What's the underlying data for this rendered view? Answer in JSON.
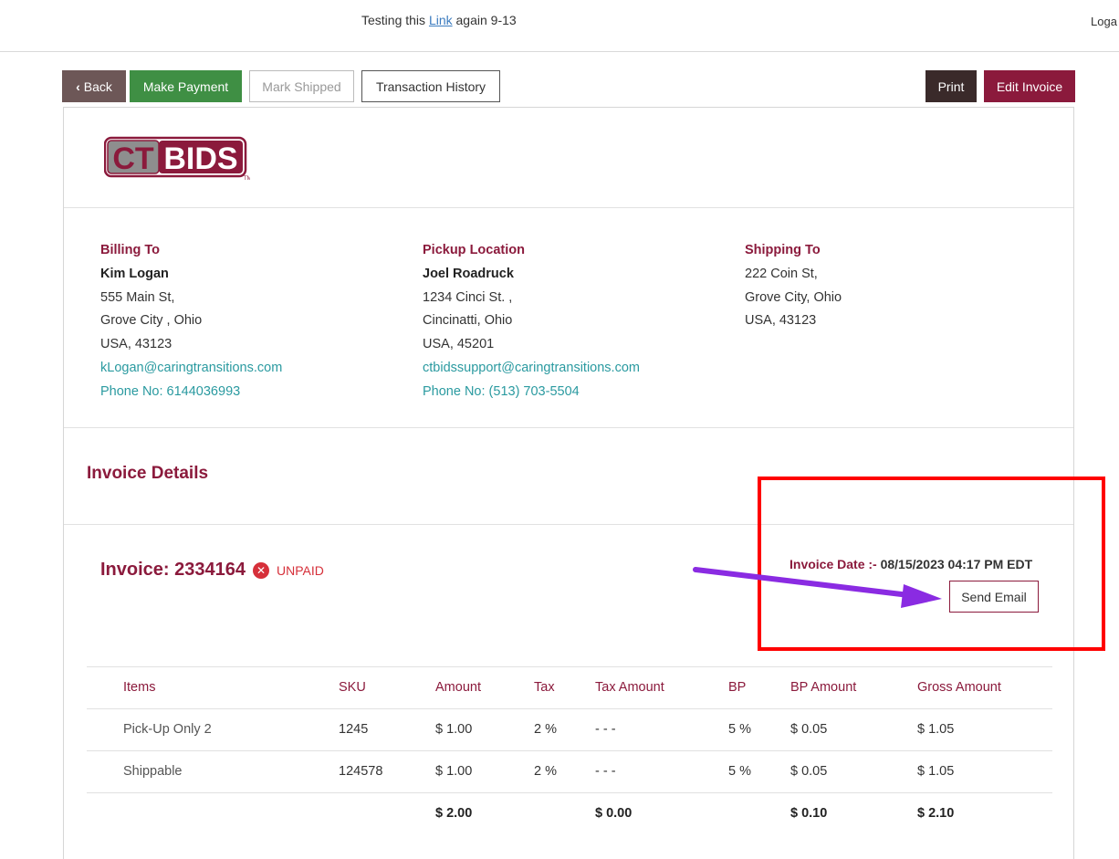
{
  "topbar": {
    "banner_prefix": "Testing this ",
    "banner_link": "Link",
    "banner_suffix": " again 9-13",
    "user": "Loga"
  },
  "actions": {
    "back": "Back",
    "make_payment": "Make Payment",
    "mark_shipped": "Mark Shipped",
    "transaction_history": "Transaction History",
    "print": "Print",
    "edit_invoice": "Edit Invoice"
  },
  "logo": {
    "text": "CT BIDS",
    "left": "CT",
    "right": "BIDS",
    "tm": "TM"
  },
  "billing": {
    "heading": "Billing To",
    "name": "Kim Logan",
    "line1": "555 Main St,",
    "line2": "Grove City , Ohio",
    "line3": "USA, 43123",
    "email": "kLogan@caringtransitions.com",
    "phone": "Phone No: 6144036993"
  },
  "pickup": {
    "heading": "Pickup Location",
    "name": "Joel Roadruck",
    "line1": "1234 Cinci St. ,",
    "line2": "Cincinatti, Ohio",
    "line3": "USA, 45201",
    "email": "ctbidssupport@caringtransitions.com",
    "phone": "Phone No: (513) 703-5504"
  },
  "shipping": {
    "heading": "Shipping To",
    "line1": "222 Coin St,",
    "line2": "Grove City, Ohio",
    "line3": "USA, 43123"
  },
  "details": {
    "title": "Invoice Details"
  },
  "invoice": {
    "number": "Invoice: 2334164",
    "status": "UNPAID",
    "date_label": "Invoice Date :- ",
    "date_value": "08/15/2023 04:17 PM EDT",
    "send_email": "Send Email"
  },
  "table": {
    "headers": [
      "Items",
      "SKU",
      "Amount",
      "Tax",
      "Tax Amount",
      "BP",
      "BP Amount",
      "Gross Amount"
    ],
    "rows": [
      [
        "Pick-Up Only 2",
        "1245",
        "$ 1.00",
        "2 %",
        "- - -",
        "5 %",
        "$ 0.05",
        "$ 1.05"
      ],
      [
        "Shippable",
        "124578",
        "$ 1.00",
        "2 %",
        "- - -",
        "5 %",
        "$ 0.05",
        "$ 1.05"
      ]
    ],
    "totals": {
      "amount": "$ 2.00",
      "tax_amount": "$ 0.00",
      "bp_amount": "$ 0.10",
      "gross_amount": "$ 2.10"
    }
  },
  "colors": {
    "brand": "#8b1a3c",
    "teal": "#2a9aa0",
    "success": "#3f8f44",
    "danger": "#d6303a",
    "annotation_box": "#ff0000",
    "annotation_arrow": "#8a2be2"
  }
}
